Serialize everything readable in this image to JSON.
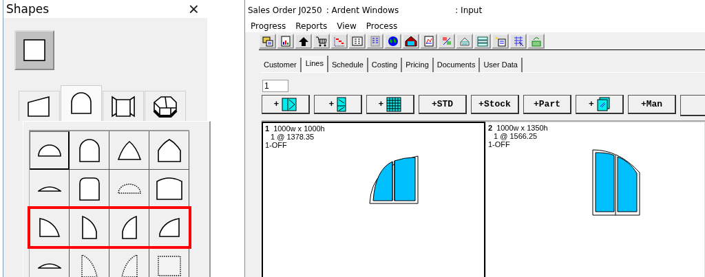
{
  "shapes_panel": {
    "title": "Shapes",
    "close": "×",
    "main_shape": {
      "kind": "square"
    },
    "tabs": [
      {
        "kind": "trapezoid",
        "selected": false
      },
      {
        "kind": "arch",
        "selected": true
      },
      {
        "kind": "bay",
        "selected": false
      },
      {
        "kind": "conservatory",
        "selected": false
      }
    ],
    "grid_rows": [
      {
        "highlighted": false,
        "cells": [
          {
            "kind": "half-round",
            "selected": true
          },
          {
            "kind": "round-top",
            "selected": false
          },
          {
            "kind": "pointed",
            "selected": false
          },
          {
            "kind": "gothic",
            "selected": false
          }
        ]
      },
      {
        "highlighted": false,
        "cells": [
          {
            "kind": "segment",
            "selected": false
          },
          {
            "kind": "flat-round",
            "selected": false
          },
          {
            "kind": "dotted-half",
            "selected": false
          },
          {
            "kind": "wide-round",
            "selected": false
          }
        ]
      },
      {
        "highlighted": true,
        "cells": [
          {
            "kind": "quarter-right",
            "selected": false
          },
          {
            "kind": "quarter-tall-right",
            "selected": false
          },
          {
            "kind": "quarter-tall-left",
            "selected": false
          },
          {
            "kind": "quarter-left",
            "selected": false
          }
        ]
      },
      {
        "highlighted": false,
        "cells": [
          {
            "kind": "segment",
            "selected": false
          },
          {
            "kind": "dotted-quarter-right",
            "selected": false
          },
          {
            "kind": "dotted-quarter-left",
            "selected": false
          },
          {
            "kind": "dotted-rect",
            "selected": false
          }
        ]
      }
    ]
  },
  "order_window": {
    "title": {
      "order": "Sales Order J0250",
      "customer": ": Ardent Windows",
      "mode": ": Input"
    },
    "menu": [
      "Progress",
      "Reports",
      "View",
      "Process"
    ],
    "tabs": [
      {
        "label": "Customer",
        "selected": false
      },
      {
        "label": "Lines",
        "selected": true
      },
      {
        "label": "Schedule",
        "selected": false
      },
      {
        "label": "Costing",
        "selected": false
      },
      {
        "label": "Pricing",
        "selected": false
      },
      {
        "label": "Documents",
        "selected": false
      },
      {
        "label": "User Data",
        "selected": false
      }
    ],
    "line_field": {
      "value": "1"
    },
    "add_buttons": [
      {
        "label": "+",
        "kind": "frame"
      },
      {
        "label": "+",
        "kind": "door"
      },
      {
        "label": "+",
        "kind": "grid"
      },
      {
        "label": "+STD",
        "kind": "text"
      },
      {
        "label": "+Stock",
        "kind": "text"
      },
      {
        "label": "+Part",
        "kind": "text"
      },
      {
        "label": "+",
        "kind": "copy"
      },
      {
        "label": "+Man",
        "kind": "text"
      },
      {
        "kind": "partial"
      }
    ],
    "lines": [
      {
        "number": "1",
        "size": "1000w x 1000h",
        "price": "1 @ 1378.35",
        "note": "1-OFF",
        "kind": "quarter-arch",
        "selected": true
      },
      {
        "number": "2",
        "size": "1000w x 1350h",
        "price": "1 @ 1566.25",
        "note": "1-OFF",
        "kind": "tall-arch",
        "selected": false
      }
    ]
  }
}
